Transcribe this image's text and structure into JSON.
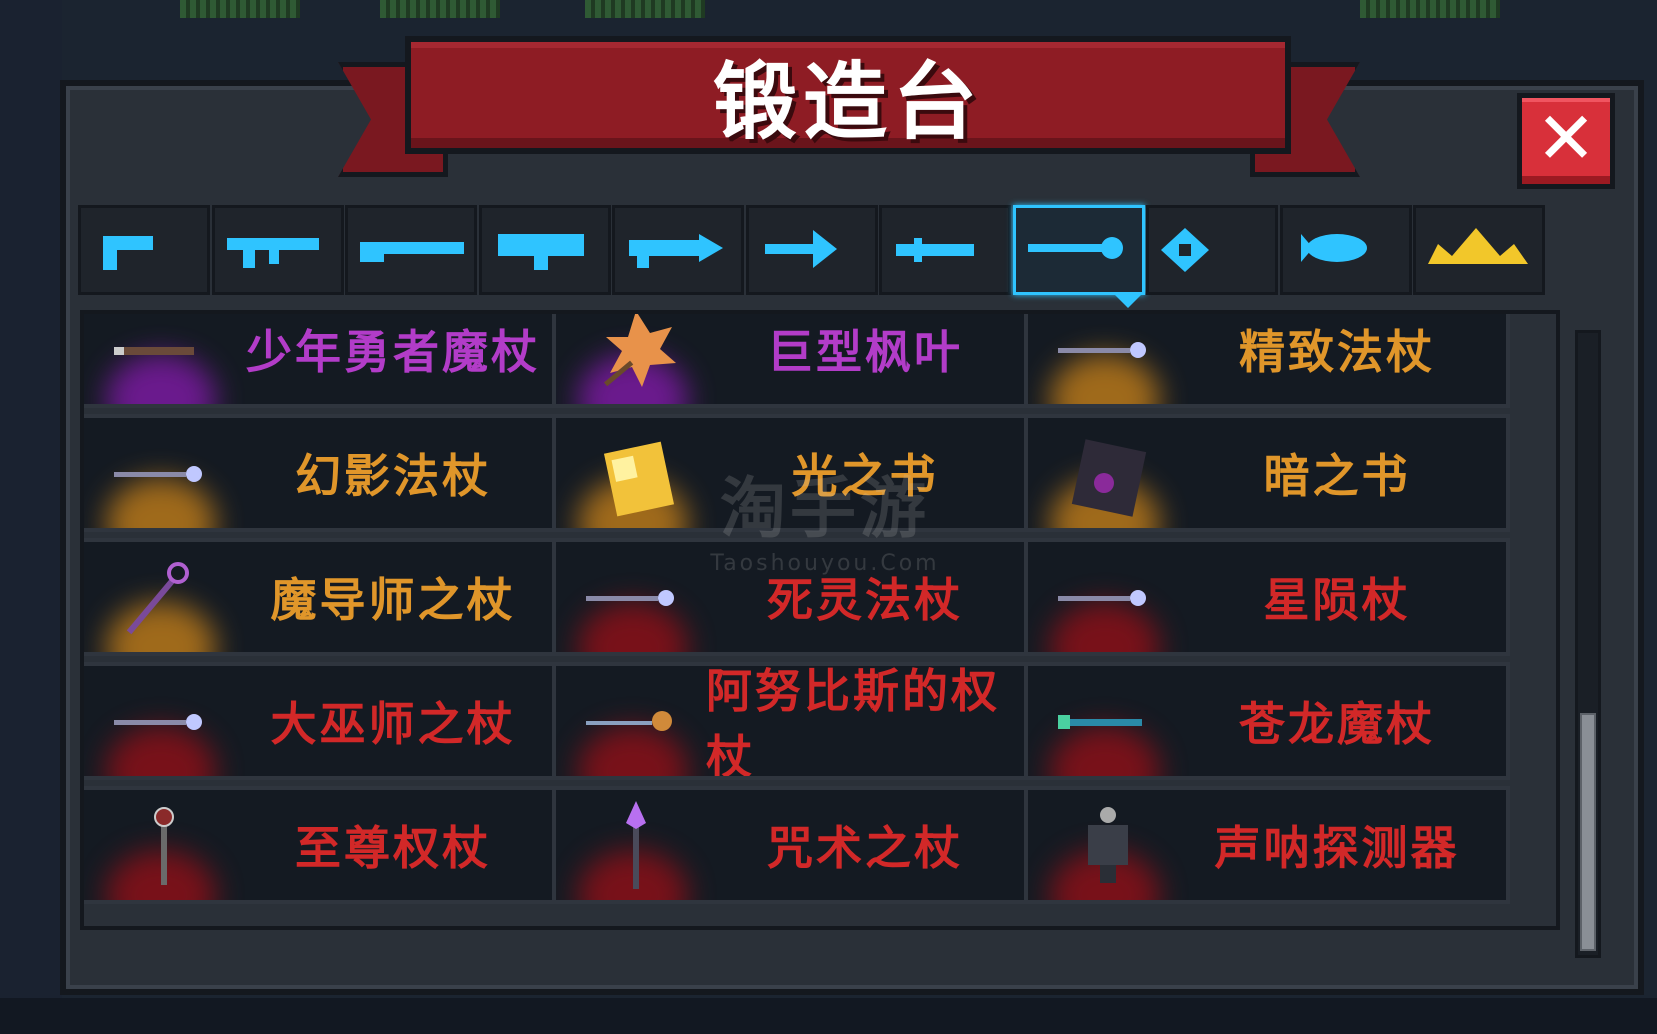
{
  "window": {
    "title": "锻造台",
    "close_label": "✕"
  },
  "colors": {
    "purple": "#b23cc8",
    "orange": "#e0962a",
    "red": "#d22828",
    "tab_icon": "#2fc4ff",
    "tab_icon_special": "#f2c72a"
  },
  "tabs": [
    {
      "icon": "pistol-icon",
      "active": false
    },
    {
      "icon": "rifle-icon",
      "active": false
    },
    {
      "icon": "shotgun-icon",
      "active": false
    },
    {
      "icon": "launcher-icon",
      "active": false
    },
    {
      "icon": "laser-rifle-icon",
      "active": false
    },
    {
      "icon": "bow-icon",
      "active": false
    },
    {
      "icon": "melee-weapon-icon",
      "active": false
    },
    {
      "icon": "staff-icon",
      "active": true
    },
    {
      "icon": "throwing-star-icon",
      "active": false
    },
    {
      "icon": "fish-icon",
      "active": false
    },
    {
      "icon": "special-crown-icon",
      "active": false
    }
  ],
  "items": [
    {
      "name": "少年勇者魔杖",
      "rarity": "purple",
      "icon": "wand-icon"
    },
    {
      "name": "巨型枫叶",
      "rarity": "purple",
      "icon": "maple-leaf-icon"
    },
    {
      "name": "精致法杖",
      "rarity": "orange",
      "icon": "staff-icon"
    },
    {
      "name": "幻影法杖",
      "rarity": "orange",
      "icon": "staff-icon"
    },
    {
      "name": "光之书",
      "rarity": "orange",
      "icon": "golden-book-icon"
    },
    {
      "name": "暗之书",
      "rarity": "orange",
      "icon": "dark-book-icon"
    },
    {
      "name": "魔导师之杖",
      "rarity": "orange",
      "icon": "mage-staff-icon"
    },
    {
      "name": "死灵法杖",
      "rarity": "red",
      "icon": "staff-icon"
    },
    {
      "name": "星陨杖",
      "rarity": "red",
      "icon": "staff-icon"
    },
    {
      "name": "大巫师之杖",
      "rarity": "red",
      "icon": "staff-icon"
    },
    {
      "name": "阿努比斯的权杖",
      "rarity": "red",
      "icon": "scepter-icon"
    },
    {
      "name": "苍龙魔杖",
      "rarity": "red",
      "icon": "dragon-staff-icon"
    },
    {
      "name": "至尊权杖",
      "rarity": "red",
      "icon": "vertical-scepter-icon"
    },
    {
      "name": "咒术之杖",
      "rarity": "red",
      "icon": "crystal-staff-icon"
    },
    {
      "name": "声呐探测器",
      "rarity": "red",
      "icon": "sonar-device-icon"
    }
  ],
  "watermark": {
    "text": "淘手游",
    "url_text": "Taoshouyou.Com"
  }
}
